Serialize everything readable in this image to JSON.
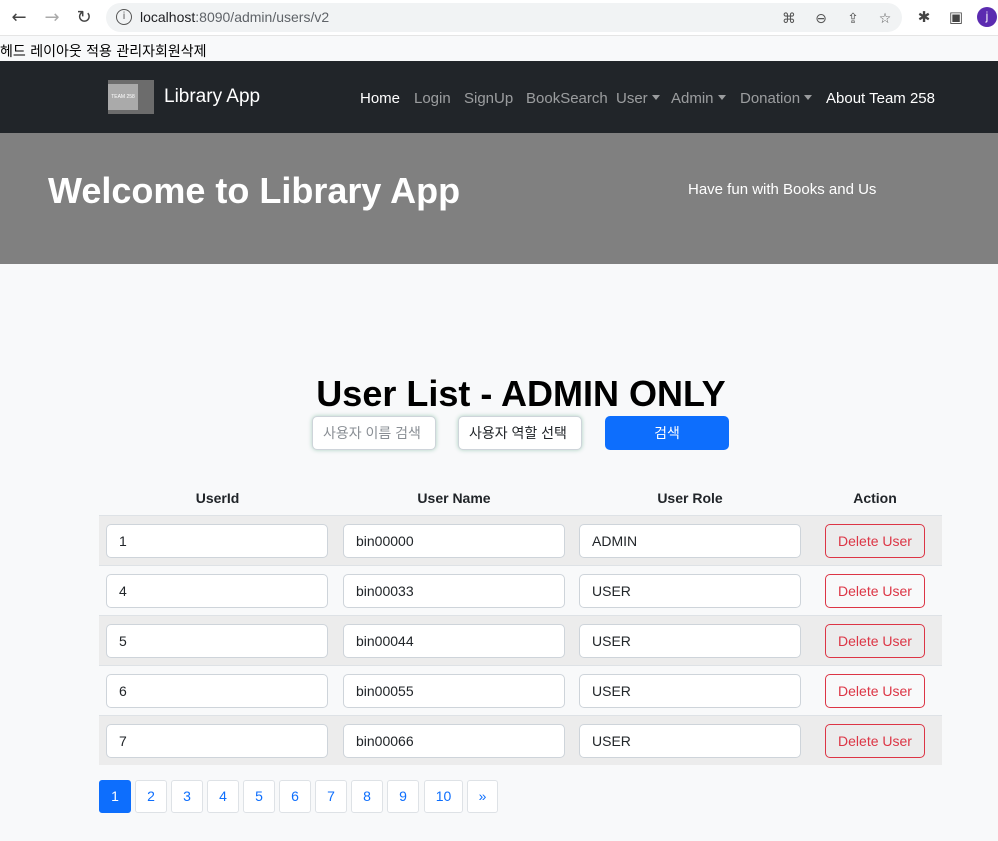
{
  "browser": {
    "url_host": "localhost",
    "url_path": ":8090/admin/users/v2",
    "avatar_initial": "j"
  },
  "page_heading": "헤드 레이아웃 적용 관리자회원삭제",
  "navbar": {
    "brand_logo_text": "TEAM 258",
    "brand_name": "Library App",
    "links": {
      "home": "Home",
      "login": "Login",
      "signup": "SignUp",
      "booksearch": "BookSearch",
      "user": "User",
      "admin": "Admin",
      "donation": "Donation",
      "about": "About Team 258"
    }
  },
  "hero": {
    "title": "Welcome to Library App",
    "tagline": "Have fun with Books and Us"
  },
  "main": {
    "title": "User List - ADMIN ONLY",
    "search": {
      "name_placeholder": "사용자 이름 검색",
      "role_placeholder": "사용자 역할 선택",
      "button_label": "검색"
    },
    "table": {
      "headers": [
        "UserId",
        "User Name",
        "User Role",
        "Action"
      ],
      "rows": [
        {
          "id": "1",
          "name": "bin00000",
          "role": "ADMIN",
          "action": "Delete User"
        },
        {
          "id": "4",
          "name": "bin00033",
          "role": "USER",
          "action": "Delete User"
        },
        {
          "id": "5",
          "name": "bin00044",
          "role": "USER",
          "action": "Delete User"
        },
        {
          "id": "6",
          "name": "bin00055",
          "role": "USER",
          "action": "Delete User"
        },
        {
          "id": "7",
          "name": "bin00066",
          "role": "USER",
          "action": "Delete User"
        }
      ]
    },
    "pagination": {
      "pages": [
        "1",
        "2",
        "3",
        "4",
        "5",
        "6",
        "7",
        "8",
        "9",
        "10"
      ],
      "next": "»",
      "current": "1"
    }
  },
  "colors": {
    "navbar": "#212529",
    "hero": "#808080",
    "primary": "#0d6efd",
    "danger": "#dc3545"
  }
}
